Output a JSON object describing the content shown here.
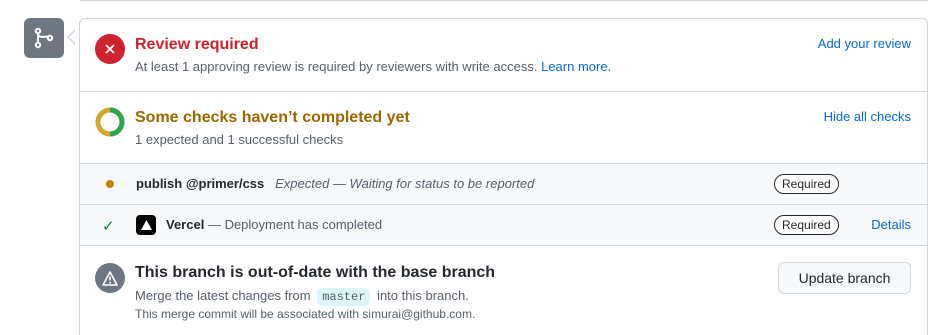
{
  "review": {
    "title": "Review required",
    "subtitle": "At least 1 approving review is required by reviewers with write access.",
    "learn_more": "Learn more.",
    "action": "Add your review"
  },
  "checks": {
    "title": "Some checks haven’t completed yet",
    "subtitle": "1 expected and 1 successful checks",
    "action": "Hide all checks",
    "items": [
      {
        "name": "publish @primer/css",
        "status": "Expected — Waiting for status to be reported",
        "badge": "Required"
      },
      {
        "name": "Vercel",
        "status": "— Deployment has completed",
        "badge": "Required",
        "details": "Details"
      }
    ]
  },
  "branch": {
    "title": "This branch is out-of-date with the base branch",
    "line1_before": "Merge the latest changes from",
    "base_branch": "master",
    "line1_after": "into this branch.",
    "line2": "This merge commit will be associated with simurai@github.com.",
    "button": "Update branch"
  },
  "colors": {
    "error": "#cf222e",
    "warning": "#9a6700",
    "success": "#1a7f37",
    "link": "#0969da",
    "muted": "#6e7781"
  },
  "icons": {
    "timeline": "git-branch-icon",
    "review": "x-circle-icon",
    "checks": "progress-ring-icon",
    "pending": "dot-icon",
    "success": "check-icon",
    "vercel": "vercel-logo-icon",
    "branch": "alert-triangle-icon"
  }
}
